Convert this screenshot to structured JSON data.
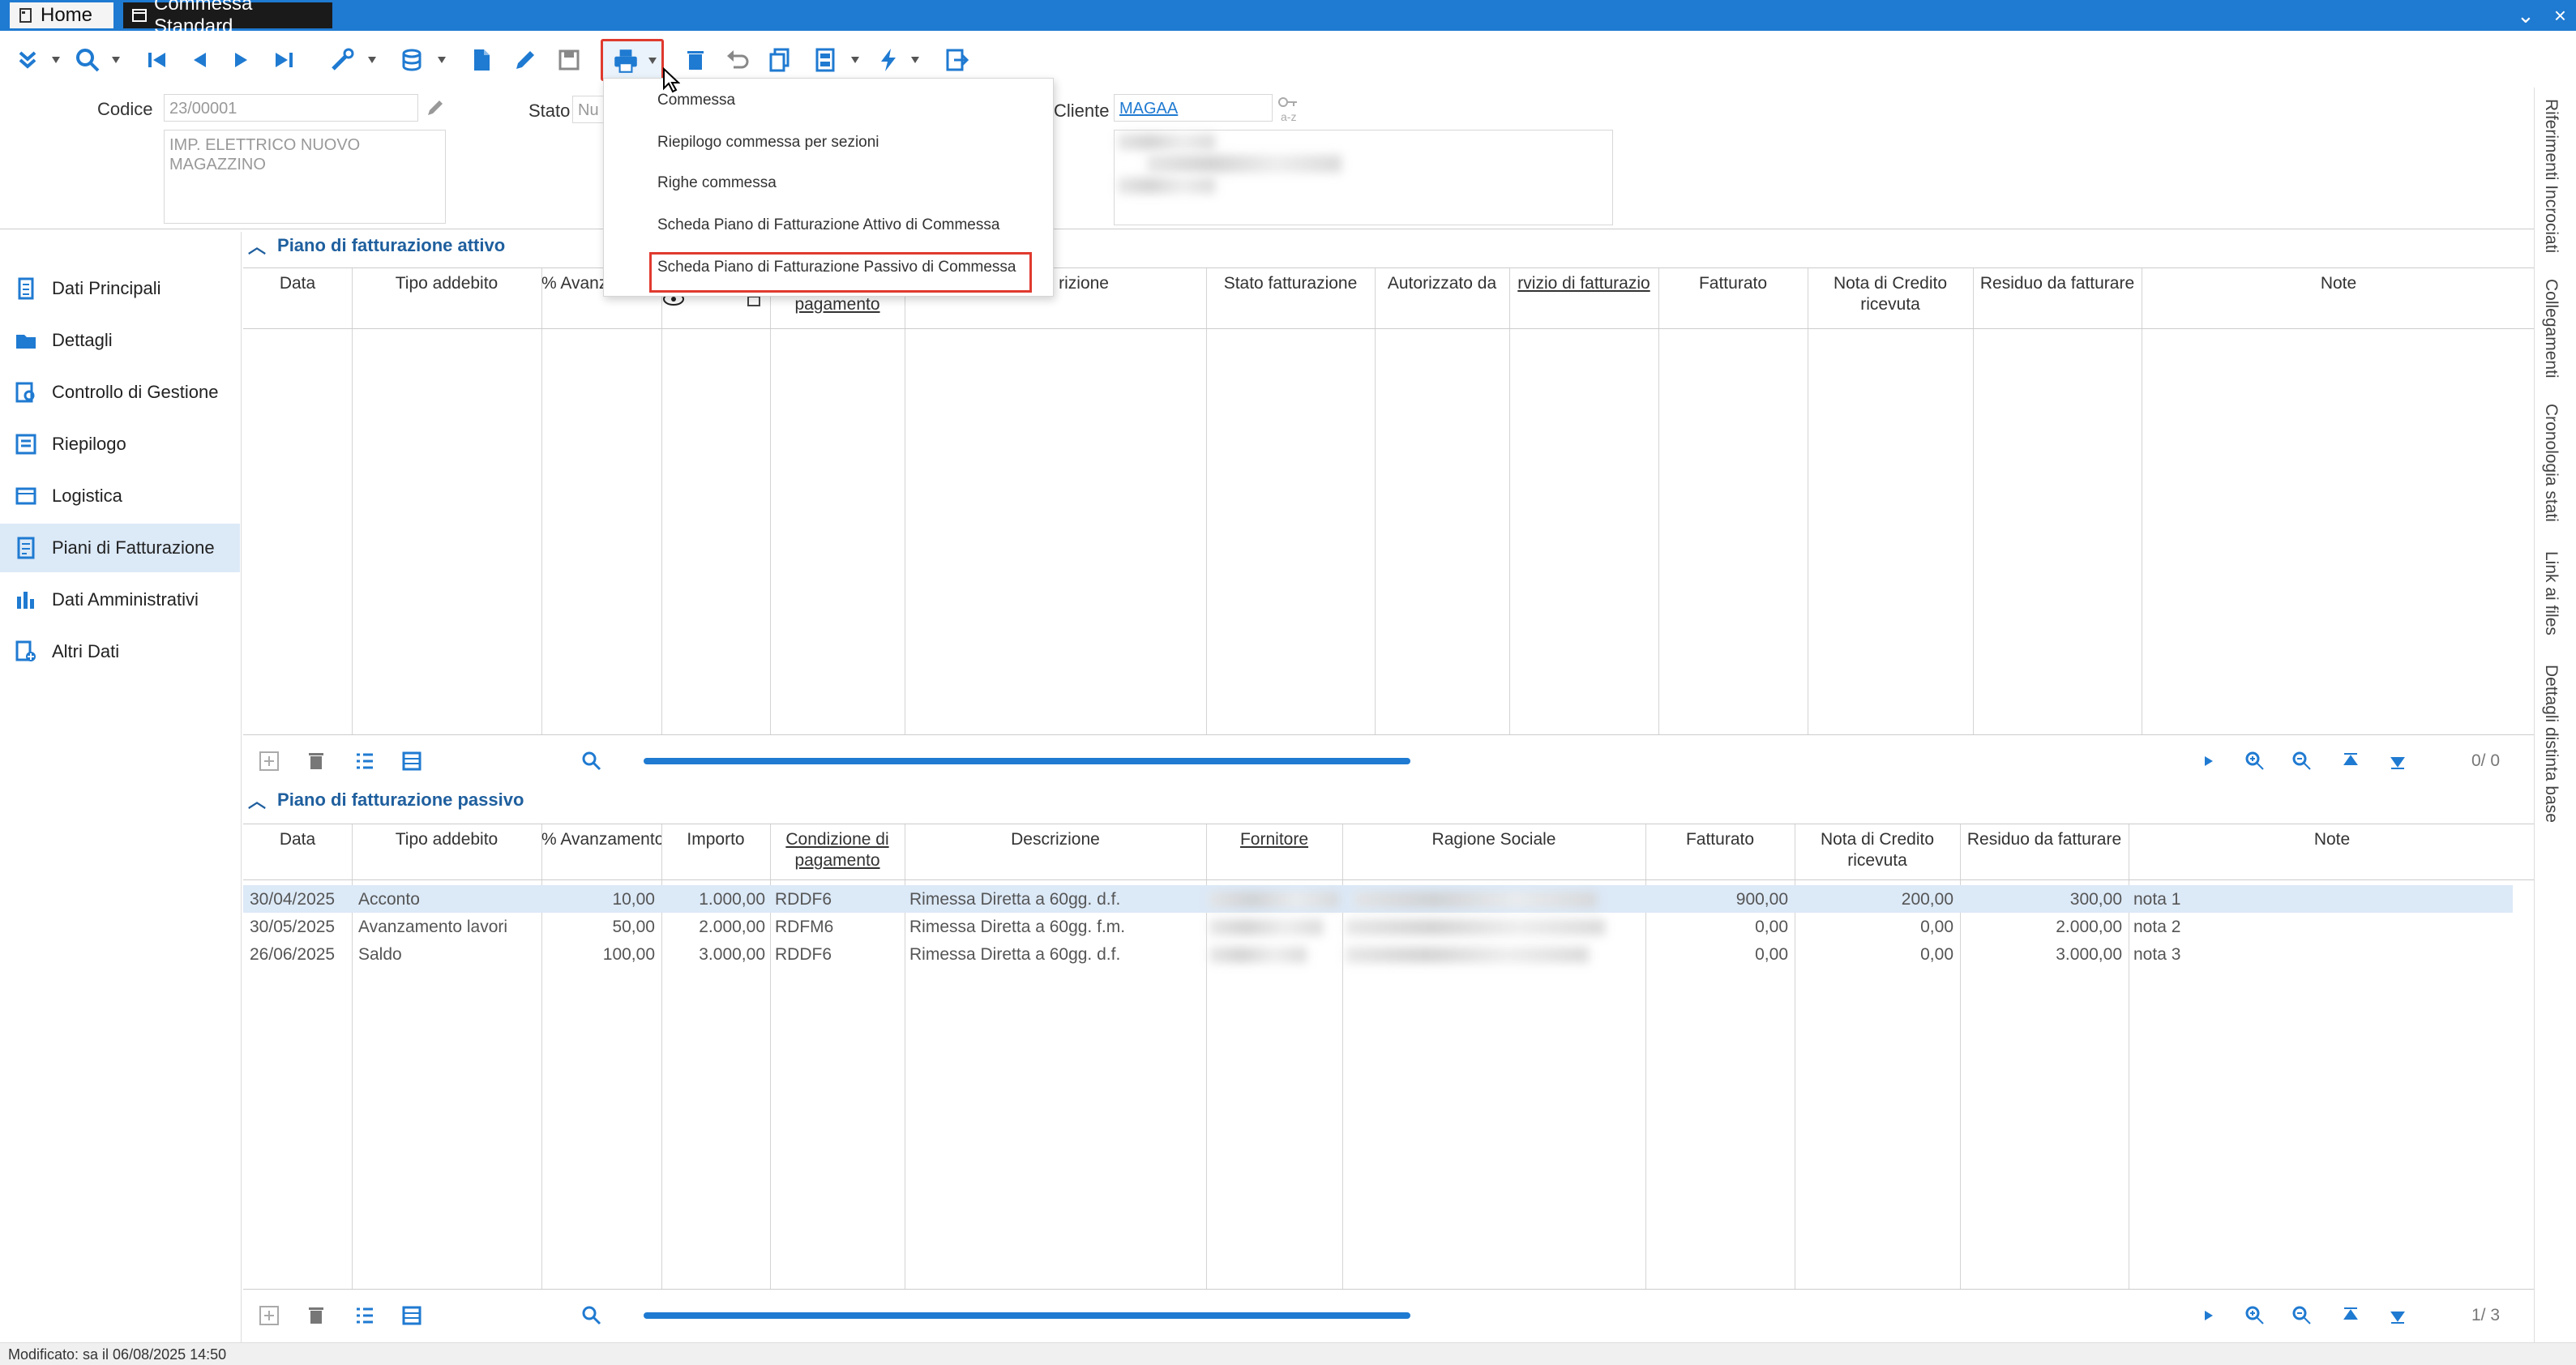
{
  "tabs": {
    "home": "Home",
    "doc": "Commessa Standard"
  },
  "window": {
    "min": "⌄",
    "close": "×"
  },
  "header": {
    "codice_label": "Codice",
    "codice_value": "23/00001",
    "descr_line1": "IMP. ELETTRICO NUOVO",
    "descr_line2": "MAGAZZINO",
    "stato_label": "Stato",
    "stato_value": "Nu",
    "cliente_label": "Cliente",
    "cliente_value": "MAGAA",
    "cliente_hint": "a-z"
  },
  "print_menu": {
    "items": [
      "Commessa",
      "Riepilogo commessa per sezioni",
      "Righe commessa",
      "Scheda Piano di Fatturazione Attivo di Commessa",
      "Scheda Piano di Fatturazione Passivo di Commessa"
    ]
  },
  "sidenav": {
    "items": [
      {
        "label": "Dati Principali"
      },
      {
        "label": "Dettagli"
      },
      {
        "label": "Controllo di Gestione"
      },
      {
        "label": "Riepilogo"
      },
      {
        "label": "Logistica"
      },
      {
        "label": "Piani di Fatturazione"
      },
      {
        "label": "Dati Amministrativi"
      },
      {
        "label": "Altri Dati"
      }
    ]
  },
  "attivo": {
    "title": "Piano di fatturazione attivo",
    "cols": {
      "data": "Data",
      "tipo": "Tipo addebito",
      "avanz": "% Avanzamento",
      "cond1": "pagamento",
      "descr": "rizione",
      "stato": "Stato fatturazione",
      "aut": "Autorizzato da",
      "serv": "rvizio di fatturazio",
      "fatt": "Fatturato",
      "nota1": "Nota di Credito",
      "nota2": "ricevuta",
      "residuo": "Residuo da fatturare",
      "note": "Note"
    },
    "pager": "0/  0"
  },
  "passivo": {
    "title": "Piano di fatturazione passivo",
    "cols": {
      "data": "Data",
      "tipo": "Tipo addebito",
      "avanz": "% Avanzamento",
      "importo": "Importo",
      "cond1": "Condizione di",
      "cond2": "pagamento",
      "descr": "Descrizione",
      "forn": "Fornitore",
      "rag": "Ragione Sociale",
      "fatt": "Fatturato",
      "nota1": "Nota di Credito",
      "nota2": "ricevuta",
      "residuo": "Residuo da fatturare",
      "note": "Note"
    },
    "rows": [
      {
        "data": "30/04/2025",
        "tipo": "Acconto",
        "avanz": "10,00",
        "importo": "1.000,00",
        "cond": "RDDF6",
        "descr": "Rimessa Diretta a 60gg. d.f.",
        "fatt": "900,00",
        "nota": "200,00",
        "residuo": "300,00",
        "note": "nota 1"
      },
      {
        "data": "30/05/2025",
        "tipo": "Avanzamento lavori",
        "avanz": "50,00",
        "importo": "2.000,00",
        "cond": "RDFM6",
        "descr": "Rimessa Diretta a 60gg. f.m.",
        "fatt": "0,00",
        "nota": "0,00",
        "residuo": "2.000,00",
        "note": "nota 2"
      },
      {
        "data": "26/06/2025",
        "tipo": "Saldo",
        "avanz": "100,00",
        "importo": "3.000,00",
        "cond": "RDDF6",
        "descr": "Rimessa Diretta a 60gg. d.f.",
        "fatt": "0,00",
        "nota": "0,00",
        "residuo": "3.000,00",
        "note": "nota 3"
      }
    ],
    "pager": "1/  3"
  },
  "rail": [
    "Riferimenti Incrociati",
    "Collegamenti",
    "Cronologia stati",
    "Link ai files",
    "Dettagli distinta base"
  ],
  "status": "Modificato: sa il 06/08/2025 14:50",
  "colors": {
    "accent": "#1f7ad1",
    "highlight": "#e03a2f",
    "selected": "#dce9f7"
  }
}
